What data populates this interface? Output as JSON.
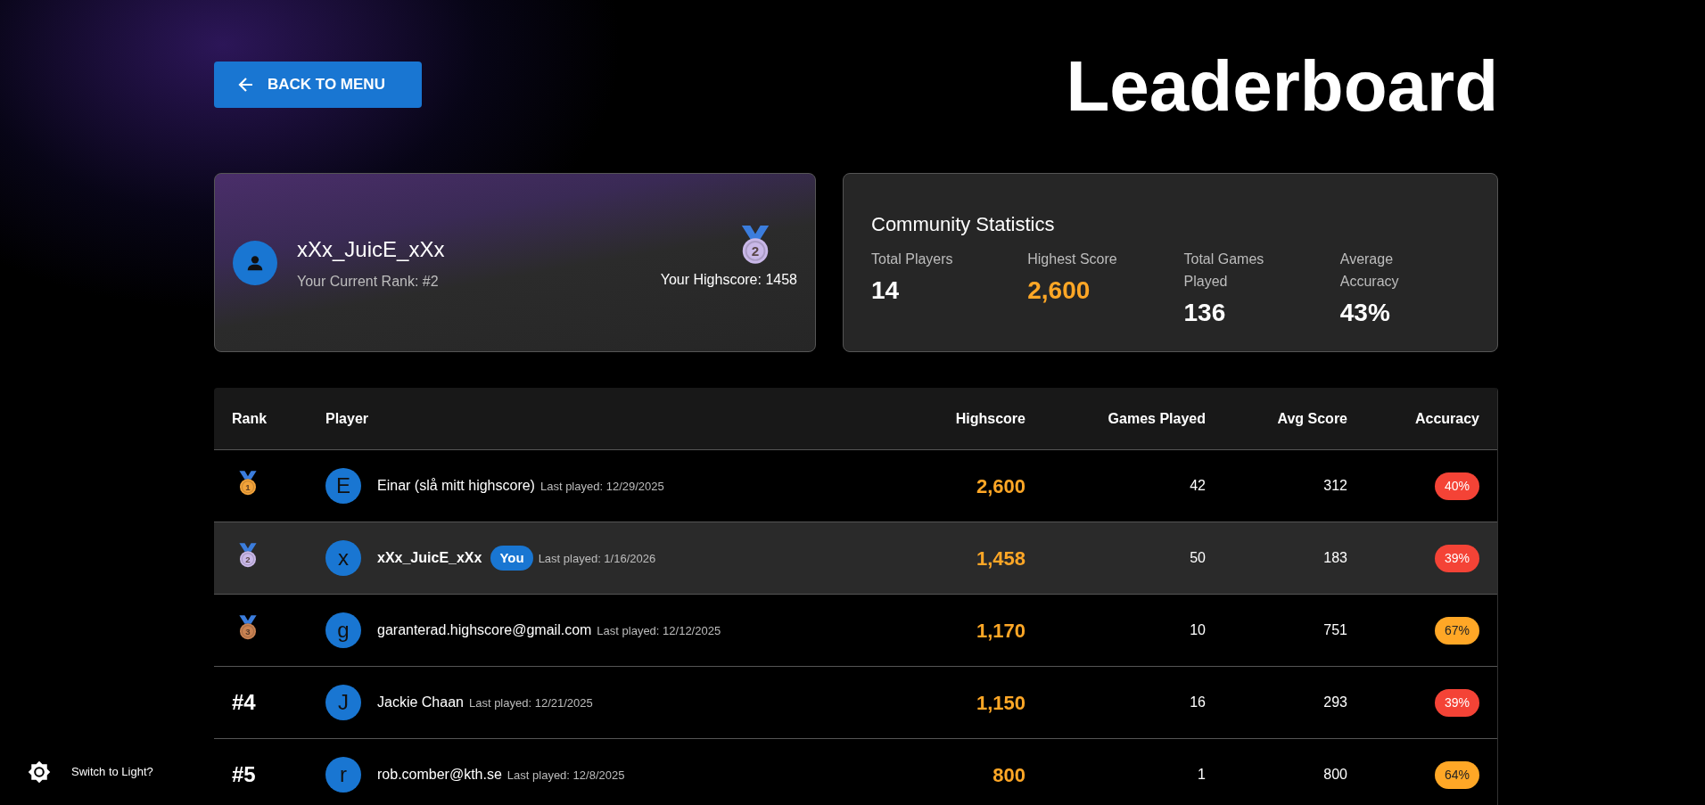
{
  "back_button": {
    "label": "BACK TO MENU"
  },
  "title": "Leaderboard",
  "profile": {
    "name": "xXx_JuicE_xXx",
    "rank": "Your Current Rank: #2",
    "medal": {
      "number": "2",
      "color": "#c9b8e8"
    },
    "highscore": "Your Highscore: 1458"
  },
  "community": {
    "title": "Community Statistics",
    "stats": [
      {
        "label": "Total Players",
        "value": "14",
        "highlight": false
      },
      {
        "label": "Highest Score",
        "value": "2,600",
        "highlight": true
      },
      {
        "label": "Total Games Played",
        "value": "136",
        "highlight": false
      },
      {
        "label": "Average Accuracy",
        "value": "43%",
        "highlight": false
      }
    ]
  },
  "table": {
    "columns": [
      "Rank",
      "Player",
      "Highscore",
      "Games Played",
      "Avg Score",
      "Accuracy"
    ],
    "rows": [
      {
        "kind": "medal",
        "rank": "1",
        "medal": {
          "color": "#f3a33a"
        },
        "initial": "E",
        "name": "Einar (slå mitt highscore)",
        "selected": false,
        "last_played": "Last played: 12/29/2025",
        "highscore": "2,600",
        "games": "42",
        "avg": "312",
        "accuracy": {
          "text": "40%",
          "color": "#f44336"
        }
      },
      {
        "kind": "medal",
        "rank": "2",
        "medal": {
          "color": "#c9b8e8"
        },
        "initial": "x",
        "name": "xXx_JuicE_xXx",
        "selected": true,
        "you_badge": "You",
        "last_played": "Last played: 1/16/2026",
        "highscore": "1,458",
        "games": "50",
        "avg": "183",
        "accuracy": {
          "text": "39%",
          "color": "#f44336"
        }
      },
      {
        "kind": "medal",
        "rank": "3",
        "medal": {
          "color": "#c98252"
        },
        "initial": "g",
        "name": "garanterad.highscore@gmail.com",
        "selected": false,
        "last_played": "Last played: 12/12/2025",
        "highscore": "1,170",
        "games": "10",
        "avg": "751",
        "accuracy": {
          "text": "67%",
          "color": "#ffa726"
        }
      },
      {
        "kind": "text",
        "rank": "#4",
        "initial": "J",
        "name": "Jackie Chaan",
        "selected": false,
        "last_played": "Last played: 12/21/2025",
        "highscore": "1,150",
        "games": "16",
        "avg": "293",
        "accuracy": {
          "text": "39%",
          "color": "#f44336"
        }
      },
      {
        "kind": "text",
        "rank": "#5",
        "initial": "r",
        "name": "rob.comber@kth.se",
        "selected": false,
        "last_played": "Last played: 12/8/2025",
        "highscore": "800",
        "games": "1",
        "avg": "800",
        "accuracy": {
          "text": "64%",
          "color": "#ffa726"
        }
      }
    ]
  },
  "theme_toggle": {
    "label": "Switch to Light?"
  }
}
